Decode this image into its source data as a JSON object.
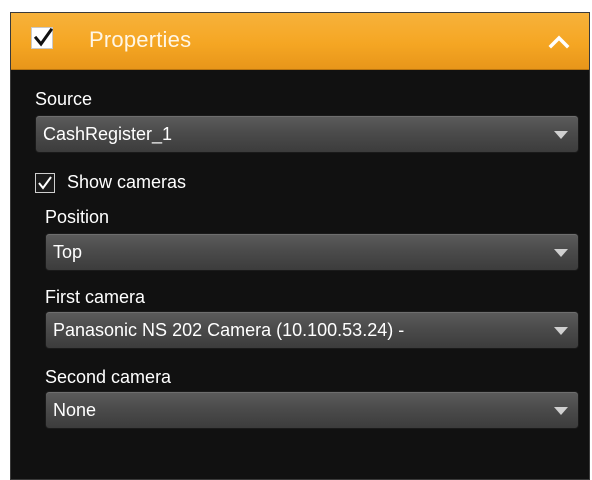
{
  "panel": {
    "title": "Properties",
    "enabled": true,
    "header_color": "#f5a623",
    "icons": {
      "enable_check": "check-icon",
      "collapse": "chevron-up-icon"
    }
  },
  "source": {
    "label": "Source",
    "selected": "CashRegister_1"
  },
  "show_cameras": {
    "label": "Show cameras",
    "checked": true
  },
  "position": {
    "label": "Position",
    "selected": "Top"
  },
  "first_camera": {
    "label": "First camera",
    "selected": "Panasonic NS 202 Camera (10.100.53.24) -"
  },
  "second_camera": {
    "label": "Second camera",
    "selected": "None"
  }
}
